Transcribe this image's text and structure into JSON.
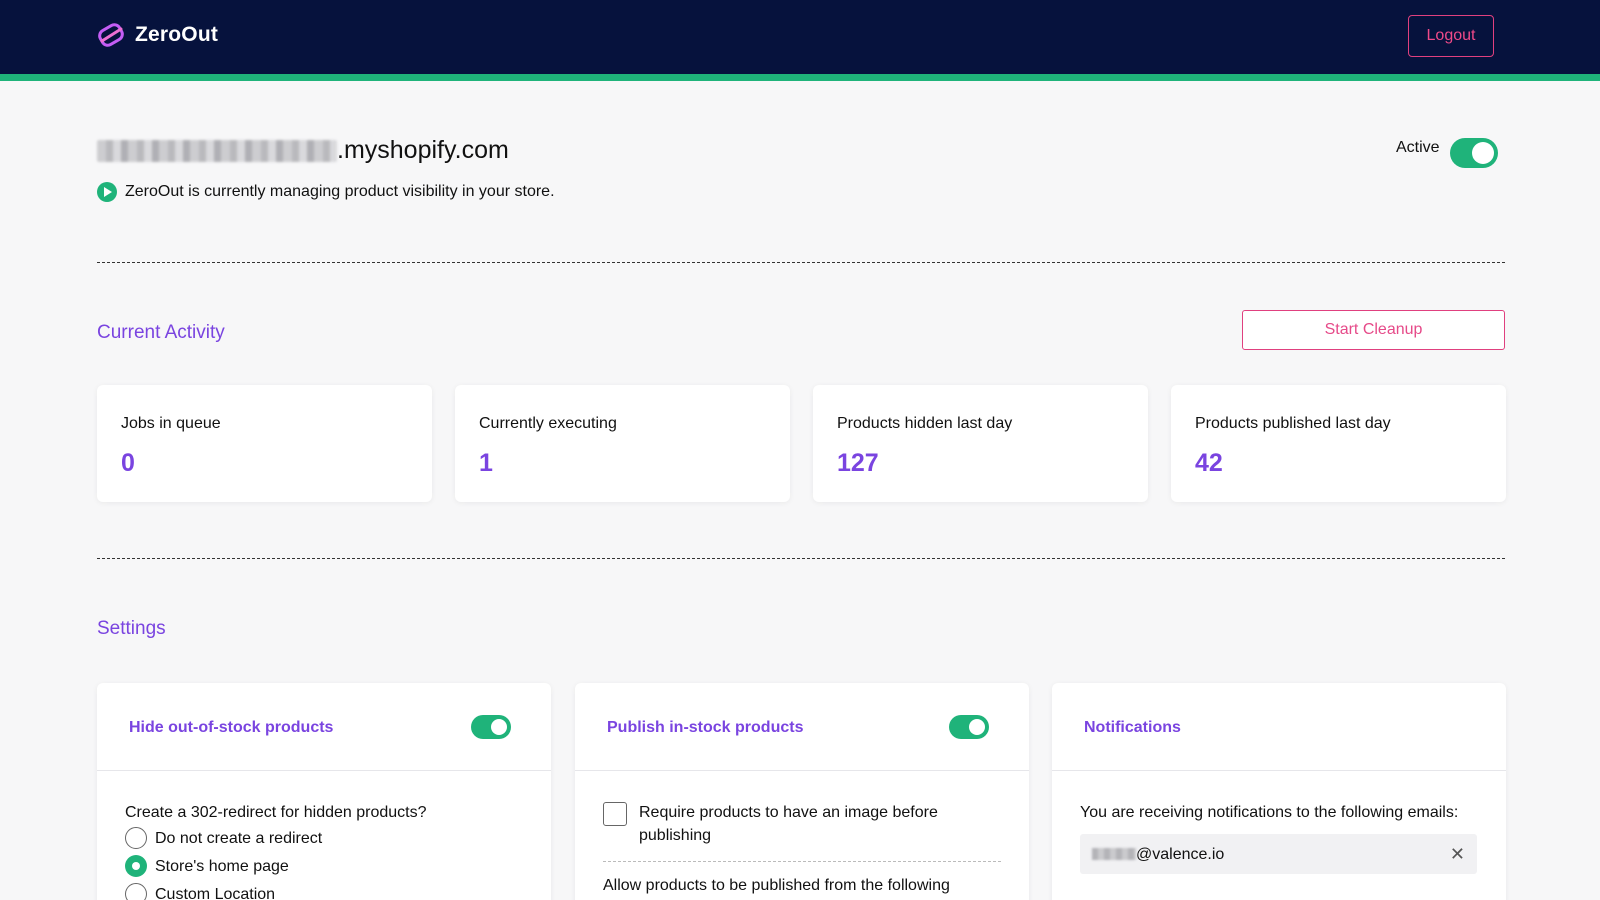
{
  "header": {
    "logo_text": "ZeroOut",
    "logout_label": "Logout"
  },
  "store": {
    "domain_suffix": ".myshopify.com",
    "status_message": "ZeroOut is currently managing product visibility in your store.",
    "active_label": "Active",
    "active": true
  },
  "activity": {
    "title": "Current Activity",
    "start_cleanup_label": "Start Cleanup",
    "stats": [
      {
        "label": "Jobs in queue",
        "value": "0"
      },
      {
        "label": "Currently executing",
        "value": "1"
      },
      {
        "label": "Products hidden last day",
        "value": "127"
      },
      {
        "label": "Products published last day",
        "value": "42"
      }
    ]
  },
  "settings": {
    "title": "Settings",
    "hide_card": {
      "title": "Hide out-of-stock products",
      "enabled": true,
      "question": "Create a 302-redirect for hidden products?",
      "options": [
        {
          "label": "Do not create a redirect",
          "selected": false
        },
        {
          "label": "Store's home page",
          "selected": true
        },
        {
          "label": "Custom Location",
          "selected": false
        }
      ]
    },
    "publish_card": {
      "title": "Publish in-stock products",
      "enabled": true,
      "require_image_label": "Require products to have an image before publishing",
      "require_image_checked": false,
      "allow_text": "Allow products to be published from the following"
    },
    "notifications_card": {
      "title": "Notifications",
      "description": "You are receiving notifications to the following emails:",
      "email_domain": "@valence.io"
    }
  },
  "colors": {
    "navy": "#06123d",
    "accent_green": "#1fb37a",
    "purple": "#7a44e0",
    "pink": "#e0407f"
  }
}
